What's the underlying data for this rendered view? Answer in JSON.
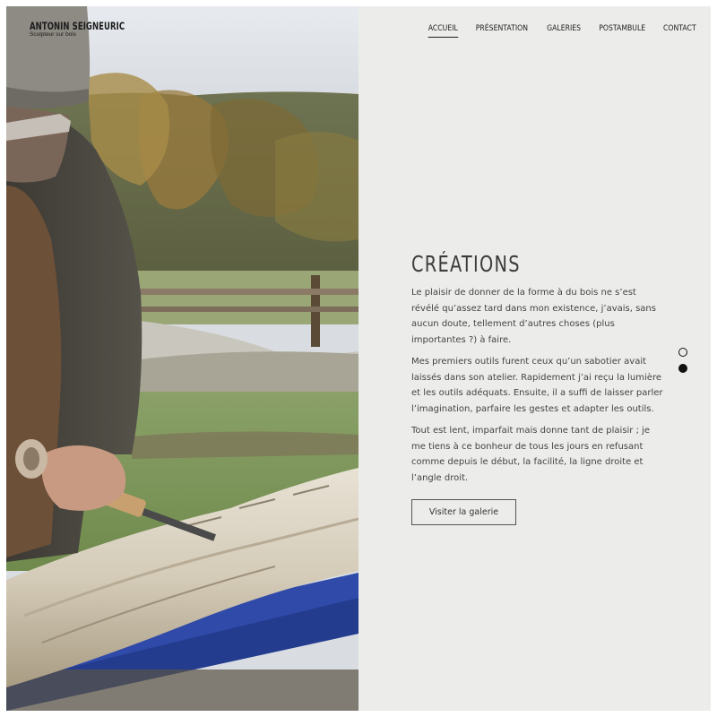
{
  "site": {
    "name": "ANTONIN SEIGNEURIC",
    "tagline": "Sculpteur sur bois"
  },
  "nav": {
    "items": [
      {
        "label": "ACCUEIL",
        "active": true
      },
      {
        "label": "PRÉSENTATION",
        "active": false
      },
      {
        "label": "GALERIES",
        "active": false
      },
      {
        "label": "POSTAMBULE",
        "active": false
      },
      {
        "label": "CONTACT",
        "active": false
      }
    ]
  },
  "hero": {
    "photo_icon": "photo-woodcarver",
    "title": "CRÉATIONS",
    "paragraphs": [
      "Le plaisir de donner de la forme à du bois ne s’est révélé qu’assez tard dans mon existence, j’avais, sans aucun doute, tellement d’autres choses (plus importantes ?) à faire.",
      "Mes premiers outils furent ceux qu’un sabotier avait laissés dans son atelier. Rapidement j’ai reçu la lumière et les outils adéquats. Ensuite, il a suffi de laisser parler l’imagination, parfaire les gestes et adapter les outils.",
      "Tout est lent, imparfait mais donne tant de plaisir ; je me tiens à ce bonheur de tous les jours en refusant comme depuis le début, la facilité, la ligne droite et l’angle droit."
    ],
    "button_label": "Visiter la galerie"
  },
  "slider": {
    "count": 2,
    "active_index": 1
  },
  "colors": {
    "panel_bg": "#ececea",
    "text": "#444444",
    "title": "#3c3c3c"
  }
}
